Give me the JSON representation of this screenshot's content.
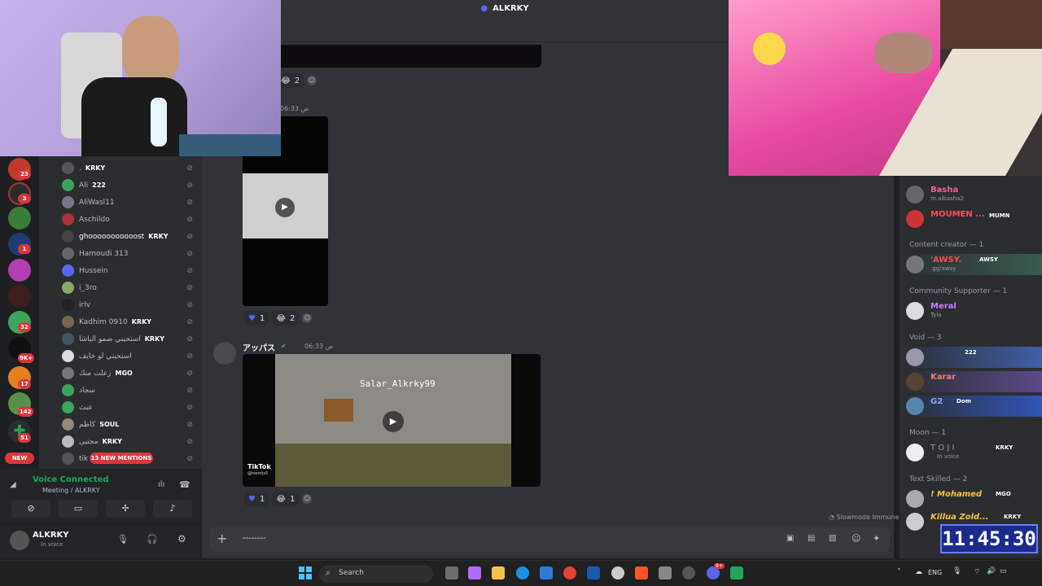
{
  "window_title": "ALKRKY",
  "server_badges": [
    "23",
    "3",
    "1",
    "32",
    "9K+",
    "17",
    "142",
    "51"
  ],
  "new_pill": "NEW",
  "voice_users": [
    {
      "name": ".",
      "tag": "KRKY"
    },
    {
      "name": "Ali",
      "tag": "222"
    },
    {
      "name": "AliWasl11",
      "tag": ""
    },
    {
      "name": "Aschildo",
      "tag": ""
    },
    {
      "name": "ghooooooooooost",
      "tag": "KRKY"
    },
    {
      "name": "Hamoudi 313",
      "tag": ""
    },
    {
      "name": "Hussein",
      "tag": ""
    },
    {
      "name": "i_3ro",
      "tag": ""
    },
    {
      "name": "irlv",
      "tag": ""
    },
    {
      "name": "Kadhim 0910",
      "tag": "KRKY"
    },
    {
      "name": "استحيني صمو الباشا",
      "tag": "KRKY"
    },
    {
      "name": "استحيني لو خايف",
      "tag": ""
    },
    {
      "name": "زعلت منك",
      "tag": "MGO"
    },
    {
      "name": "سجاد",
      "tag": ""
    },
    {
      "name": "عبث",
      "tag": ""
    },
    {
      "name": "كاظم",
      "tag": "SOUL"
    },
    {
      "name": "مجتبى",
      "tag": "KRKY"
    },
    {
      "name": "tik",
      "tag": ""
    }
  ],
  "mentions_pill": "13 NEW MENTIONS",
  "voice_panel": {
    "status": "Voice Connected",
    "channel": "Meeting / ALKRKY"
  },
  "user_panel": {
    "name": "ALKRKY",
    "status": "In voice"
  },
  "messages": [
    {
      "reactions": [
        {
          "emoji": "😂",
          "count": "2"
        }
      ]
    },
    {
      "time": "ص 06:33",
      "reactions": [
        {
          "emoji": "💙",
          "count": "1"
        },
        {
          "emoji": "😂",
          "count": "2"
        }
      ]
    },
    {
      "author": "アッパス",
      "time": "ص 06:33",
      "video_overlay": "Salar_Alkrky99",
      "watermark": "TikTok",
      "watermark_handle": "@hsnrrjs5",
      "reactions": [
        {
          "emoji": "💙",
          "count": "1"
        },
        {
          "emoji": "😂",
          "count": "1"
        }
      ]
    }
  ],
  "slowmode": "Slowmode Immune",
  "composer_text": "--------",
  "members": {
    "top": [
      {
        "name": "Basha",
        "sub": "m.albasha2",
        "color": "#f06292"
      },
      {
        "name": "MOUMEN ...",
        "sub": "",
        "tag": "MUMN",
        "color": "#ff4d4d"
      }
    ],
    "groups": [
      {
        "title": "Content creator — 1",
        "items": [
          {
            "name": "'AWSY.",
            "sub": ".gg/awsy",
            "tag": "AWSY",
            "color": "#ff4d4d"
          }
        ]
      },
      {
        "title": "Community Supporter — 1",
        "items": [
          {
            "name": "Meral",
            "sub": "Tyla",
            "color": "#c77dff"
          }
        ]
      },
      {
        "title": "Void — 3",
        "items": [
          {
            "name": "",
            "sub": "",
            "tag": "222",
            "color": "#ffffff"
          },
          {
            "name": "Karar",
            "sub": "",
            "color": "#e67e73"
          },
          {
            "name": "G2",
            "sub": "",
            "tag": "Dom",
            "color": "#8ea1ff"
          }
        ]
      },
      {
        "title": "Moon — 1",
        "items": [
          {
            "name": "T O J I",
            "sub": "In voice",
            "tag": "KRKY",
            "color": "#949ba4"
          }
        ]
      },
      {
        "title": "Text Skilled — 2",
        "items": [
          {
            "name": "! Mohamed",
            "sub": "",
            "tag": "MGO",
            "color": "#f5c542"
          },
          {
            "name": "Killua Zold...",
            "sub": "",
            "tag": "KRKY",
            "color": "#f5c542"
          }
        ]
      }
    ]
  },
  "taskbar": {
    "search": "Search",
    "lang": "ENG",
    "badge": "9+"
  },
  "stream_clock": "11:45:30"
}
